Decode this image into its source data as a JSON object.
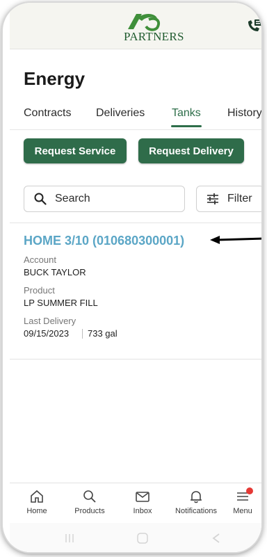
{
  "header": {
    "logo_mark": "Ag",
    "logo_text": "PARTNERS",
    "brand_color": "#1f5a2e"
  },
  "page": {
    "title": "Energy"
  },
  "tabs": [
    {
      "label": "Contracts",
      "active": false
    },
    {
      "label": "Deliveries",
      "active": false
    },
    {
      "label": "Tanks",
      "active": true
    },
    {
      "label": "History",
      "active": false
    }
  ],
  "actions": {
    "request_service": "Request Service",
    "request_delivery": "Request Delivery"
  },
  "search": {
    "label": "Search",
    "icon": "search-icon"
  },
  "filter": {
    "label": "Filter",
    "icon": "sliders-icon"
  },
  "tank": {
    "title": "HOME 3/10 (010680300001)",
    "account_label": "Account",
    "account_value": "BUCK TAYLOR",
    "product_label": "Product",
    "product_value": "LP SUMMER FILL",
    "last_delivery_label": "Last Delivery",
    "last_delivery_date": "09/15/2023",
    "last_delivery_amount": "733 gal"
  },
  "bottom_nav": [
    {
      "label": "Home",
      "icon": "home-icon"
    },
    {
      "label": "Products",
      "icon": "search-icon"
    },
    {
      "label": "Inbox",
      "icon": "envelope-icon"
    },
    {
      "label": "Notifications",
      "icon": "bell-icon"
    },
    {
      "label": "Menu",
      "icon": "menu-icon",
      "badge": true
    }
  ],
  "colors": {
    "accent": "#2f6c4a",
    "link": "#5ba6c6",
    "badge": "#e53935"
  }
}
